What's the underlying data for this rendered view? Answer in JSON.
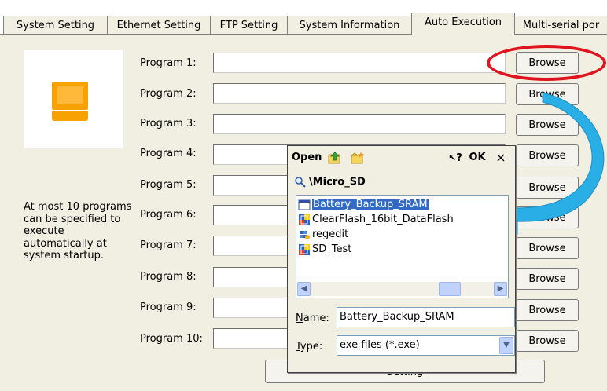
{
  "tabs": [
    {
      "label": "System Setting",
      "active": false
    },
    {
      "label": "Ethernet Setting",
      "active": false
    },
    {
      "label": "FTP Setting",
      "active": false
    },
    {
      "label": "System Information",
      "active": false
    },
    {
      "label": "Auto Execution",
      "active": true
    },
    {
      "label": "Multi-serial por",
      "active": false
    }
  ],
  "description": "At most 10 programs can be specified to execute automatically at system startup.",
  "programs": [
    {
      "label": "Program 1:",
      "value": "",
      "browse": "Browse"
    },
    {
      "label": "Program 2:",
      "value": "",
      "browse": "Browse"
    },
    {
      "label": "Program 3:",
      "value": "",
      "browse": "Browse"
    },
    {
      "label": "Program 4:",
      "value": "",
      "browse": "Browse"
    },
    {
      "label": "Program 5:",
      "value": "",
      "browse": "Browse"
    },
    {
      "label": "Program 6:",
      "value": "",
      "browse": "Browse"
    },
    {
      "label": "Program 7:",
      "value": "",
      "browse": "Browse"
    },
    {
      "label": "Program 8:",
      "value": "",
      "browse": "Browse"
    },
    {
      "label": "Program 9:",
      "value": "",
      "browse": "Browse"
    },
    {
      "label": "Program 10:",
      "value": "",
      "browse": "Browse"
    }
  ],
  "setting_button": "Setting",
  "open_dialog": {
    "title": "Open",
    "help": "?",
    "ok": "OK",
    "close": "×",
    "path": "\\Micro_SD",
    "files": [
      {
        "name": "Battery_Backup_SRAM",
        "selected": true,
        "icon": "exe-window-icon"
      },
      {
        "name": "ClearFlash_16bit_DataFlash",
        "selected": false,
        "icon": "exe-program-icon"
      },
      {
        "name": "regedit",
        "selected": false,
        "icon": "registry-icon"
      },
      {
        "name": "SD_Test",
        "selected": false,
        "icon": "exe-program-icon"
      }
    ],
    "name_label": "Name:",
    "name_value": "Battery_Backup_SRAM",
    "type_label": "Type:",
    "type_value": "exe files (*.exe)"
  },
  "colors": {
    "highlight": "#316ac5",
    "annotation_red": "#e0141e",
    "annotation_arrow": "#29aee6",
    "icon_orange": "#f7a200"
  }
}
